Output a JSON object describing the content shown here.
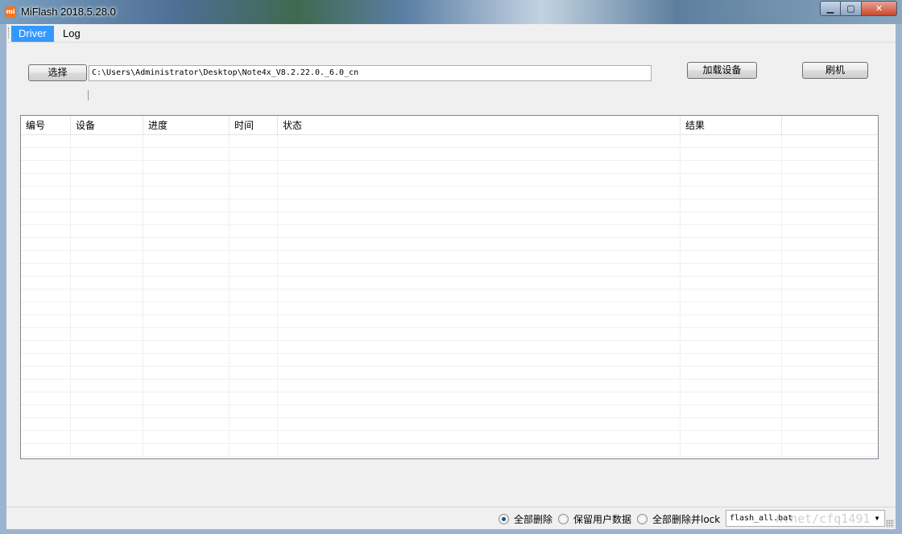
{
  "window": {
    "title": "MiFlash 2018.5.28.0",
    "app_icon_text": "mi",
    "controls": {
      "minimize": "▁",
      "maximize": "▢",
      "close": "✕"
    }
  },
  "menu": {
    "items": [
      {
        "label": "Driver",
        "active": true
      },
      {
        "label": "Log",
        "active": false
      }
    ]
  },
  "toolbar": {
    "select_button": "选择",
    "path_value": "C:\\Users\\Administrator\\Desktop\\Note4x_V8.2.22.0._6.0_cn",
    "load_device_button": "加载设备",
    "flash_button": "刷机"
  },
  "table": {
    "columns": [
      "编号",
      "设备",
      "进度",
      "时间",
      "状态",
      "结果",
      ""
    ],
    "rows": []
  },
  "status": {
    "options": [
      {
        "label": "全部删除",
        "checked": true
      },
      {
        "label": "保留用户数据",
        "checked": false
      },
      {
        "label": "全部删除并lock",
        "checked": false
      }
    ],
    "script_select": "flash_all.bat",
    "watermark": "n.net/cfq1491"
  }
}
